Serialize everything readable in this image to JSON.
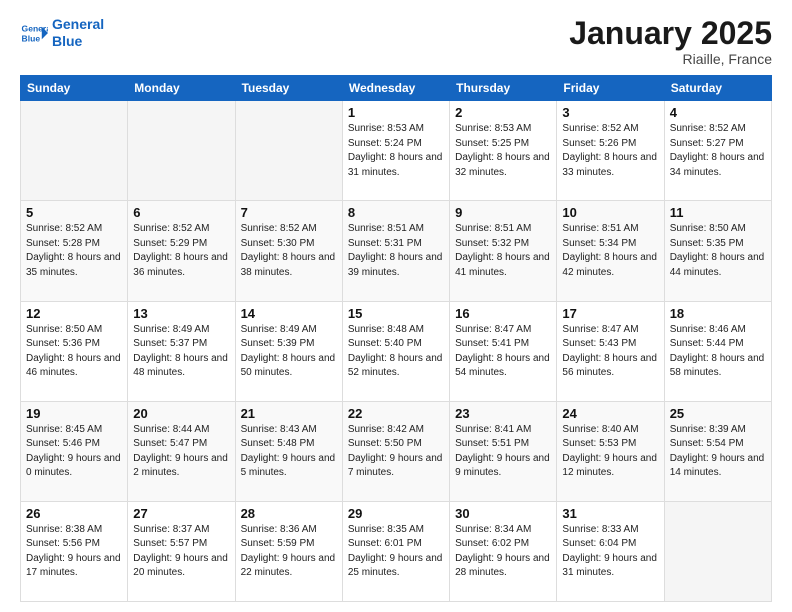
{
  "logo": {
    "line1": "General",
    "line2": "Blue"
  },
  "title": "January 2025",
  "location": "Riaille, France",
  "days_of_week": [
    "Sunday",
    "Monday",
    "Tuesday",
    "Wednesday",
    "Thursday",
    "Friday",
    "Saturday"
  ],
  "weeks": [
    [
      {
        "day": "",
        "sunrise": "",
        "sunset": "",
        "daylight": ""
      },
      {
        "day": "",
        "sunrise": "",
        "sunset": "",
        "daylight": ""
      },
      {
        "day": "",
        "sunrise": "",
        "sunset": "",
        "daylight": ""
      },
      {
        "day": "1",
        "sunrise": "Sunrise: 8:53 AM",
        "sunset": "Sunset: 5:24 PM",
        "daylight": "Daylight: 8 hours and 31 minutes."
      },
      {
        "day": "2",
        "sunrise": "Sunrise: 8:53 AM",
        "sunset": "Sunset: 5:25 PM",
        "daylight": "Daylight: 8 hours and 32 minutes."
      },
      {
        "day": "3",
        "sunrise": "Sunrise: 8:52 AM",
        "sunset": "Sunset: 5:26 PM",
        "daylight": "Daylight: 8 hours and 33 minutes."
      },
      {
        "day": "4",
        "sunrise": "Sunrise: 8:52 AM",
        "sunset": "Sunset: 5:27 PM",
        "daylight": "Daylight: 8 hours and 34 minutes."
      }
    ],
    [
      {
        "day": "5",
        "sunrise": "Sunrise: 8:52 AM",
        "sunset": "Sunset: 5:28 PM",
        "daylight": "Daylight: 8 hours and 35 minutes."
      },
      {
        "day": "6",
        "sunrise": "Sunrise: 8:52 AM",
        "sunset": "Sunset: 5:29 PM",
        "daylight": "Daylight: 8 hours and 36 minutes."
      },
      {
        "day": "7",
        "sunrise": "Sunrise: 8:52 AM",
        "sunset": "Sunset: 5:30 PM",
        "daylight": "Daylight: 8 hours and 38 minutes."
      },
      {
        "day": "8",
        "sunrise": "Sunrise: 8:51 AM",
        "sunset": "Sunset: 5:31 PM",
        "daylight": "Daylight: 8 hours and 39 minutes."
      },
      {
        "day": "9",
        "sunrise": "Sunrise: 8:51 AM",
        "sunset": "Sunset: 5:32 PM",
        "daylight": "Daylight: 8 hours and 41 minutes."
      },
      {
        "day": "10",
        "sunrise": "Sunrise: 8:51 AM",
        "sunset": "Sunset: 5:34 PM",
        "daylight": "Daylight: 8 hours and 42 minutes."
      },
      {
        "day": "11",
        "sunrise": "Sunrise: 8:50 AM",
        "sunset": "Sunset: 5:35 PM",
        "daylight": "Daylight: 8 hours and 44 minutes."
      }
    ],
    [
      {
        "day": "12",
        "sunrise": "Sunrise: 8:50 AM",
        "sunset": "Sunset: 5:36 PM",
        "daylight": "Daylight: 8 hours and 46 minutes."
      },
      {
        "day": "13",
        "sunrise": "Sunrise: 8:49 AM",
        "sunset": "Sunset: 5:37 PM",
        "daylight": "Daylight: 8 hours and 48 minutes."
      },
      {
        "day": "14",
        "sunrise": "Sunrise: 8:49 AM",
        "sunset": "Sunset: 5:39 PM",
        "daylight": "Daylight: 8 hours and 50 minutes."
      },
      {
        "day": "15",
        "sunrise": "Sunrise: 8:48 AM",
        "sunset": "Sunset: 5:40 PM",
        "daylight": "Daylight: 8 hours and 52 minutes."
      },
      {
        "day": "16",
        "sunrise": "Sunrise: 8:47 AM",
        "sunset": "Sunset: 5:41 PM",
        "daylight": "Daylight: 8 hours and 54 minutes."
      },
      {
        "day": "17",
        "sunrise": "Sunrise: 8:47 AM",
        "sunset": "Sunset: 5:43 PM",
        "daylight": "Daylight: 8 hours and 56 minutes."
      },
      {
        "day": "18",
        "sunrise": "Sunrise: 8:46 AM",
        "sunset": "Sunset: 5:44 PM",
        "daylight": "Daylight: 8 hours and 58 minutes."
      }
    ],
    [
      {
        "day": "19",
        "sunrise": "Sunrise: 8:45 AM",
        "sunset": "Sunset: 5:46 PM",
        "daylight": "Daylight: 9 hours and 0 minutes."
      },
      {
        "day": "20",
        "sunrise": "Sunrise: 8:44 AM",
        "sunset": "Sunset: 5:47 PM",
        "daylight": "Daylight: 9 hours and 2 minutes."
      },
      {
        "day": "21",
        "sunrise": "Sunrise: 8:43 AM",
        "sunset": "Sunset: 5:48 PM",
        "daylight": "Daylight: 9 hours and 5 minutes."
      },
      {
        "day": "22",
        "sunrise": "Sunrise: 8:42 AM",
        "sunset": "Sunset: 5:50 PM",
        "daylight": "Daylight: 9 hours and 7 minutes."
      },
      {
        "day": "23",
        "sunrise": "Sunrise: 8:41 AM",
        "sunset": "Sunset: 5:51 PM",
        "daylight": "Daylight: 9 hours and 9 minutes."
      },
      {
        "day": "24",
        "sunrise": "Sunrise: 8:40 AM",
        "sunset": "Sunset: 5:53 PM",
        "daylight": "Daylight: 9 hours and 12 minutes."
      },
      {
        "day": "25",
        "sunrise": "Sunrise: 8:39 AM",
        "sunset": "Sunset: 5:54 PM",
        "daylight": "Daylight: 9 hours and 14 minutes."
      }
    ],
    [
      {
        "day": "26",
        "sunrise": "Sunrise: 8:38 AM",
        "sunset": "Sunset: 5:56 PM",
        "daylight": "Daylight: 9 hours and 17 minutes."
      },
      {
        "day": "27",
        "sunrise": "Sunrise: 8:37 AM",
        "sunset": "Sunset: 5:57 PM",
        "daylight": "Daylight: 9 hours and 20 minutes."
      },
      {
        "day": "28",
        "sunrise": "Sunrise: 8:36 AM",
        "sunset": "Sunset: 5:59 PM",
        "daylight": "Daylight: 9 hours and 22 minutes."
      },
      {
        "day": "29",
        "sunrise": "Sunrise: 8:35 AM",
        "sunset": "Sunset: 6:01 PM",
        "daylight": "Daylight: 9 hours and 25 minutes."
      },
      {
        "day": "30",
        "sunrise": "Sunrise: 8:34 AM",
        "sunset": "Sunset: 6:02 PM",
        "daylight": "Daylight: 9 hours and 28 minutes."
      },
      {
        "day": "31",
        "sunrise": "Sunrise: 8:33 AM",
        "sunset": "Sunset: 6:04 PM",
        "daylight": "Daylight: 9 hours and 31 minutes."
      },
      {
        "day": "",
        "sunrise": "",
        "sunset": "",
        "daylight": ""
      }
    ]
  ]
}
